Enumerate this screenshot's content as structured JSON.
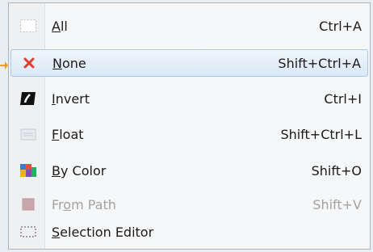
{
  "menu": {
    "items": [
      {
        "pre": "",
        "mn": "A",
        "post": "ll",
        "accel": "Ctrl+A",
        "icon": "select-all-icon",
        "state": "normal"
      },
      {
        "pre": "",
        "mn": "N",
        "post": "one",
        "accel": "Shift+Ctrl+A",
        "icon": "close-x-icon",
        "state": "highlighted"
      },
      {
        "pre": "",
        "mn": "I",
        "post": "nvert",
        "accel": "Ctrl+I",
        "icon": "invert-icon",
        "state": "normal"
      },
      {
        "pre": "",
        "mn": "F",
        "post": "loat",
        "accel": "Shift+Ctrl+L",
        "icon": "float-icon",
        "state": "normal"
      },
      {
        "pre": "",
        "mn": "B",
        "post": "y Color",
        "accel": "Shift+O",
        "icon": "by-color-icon",
        "state": "normal"
      },
      {
        "pre": "Fr",
        "mn": "o",
        "post": "m Path",
        "accel": "Shift+V",
        "icon": "from-path-icon",
        "state": "disabled"
      },
      {
        "pre": "",
        "mn": "S",
        "post": "election Editor",
        "accel": "",
        "icon": "selection-editor-icon",
        "state": "normal"
      }
    ]
  },
  "colors": {
    "highlight_border": "#a9c7e8",
    "close_x": "#e53b2c",
    "pointer": "#f39c20"
  }
}
